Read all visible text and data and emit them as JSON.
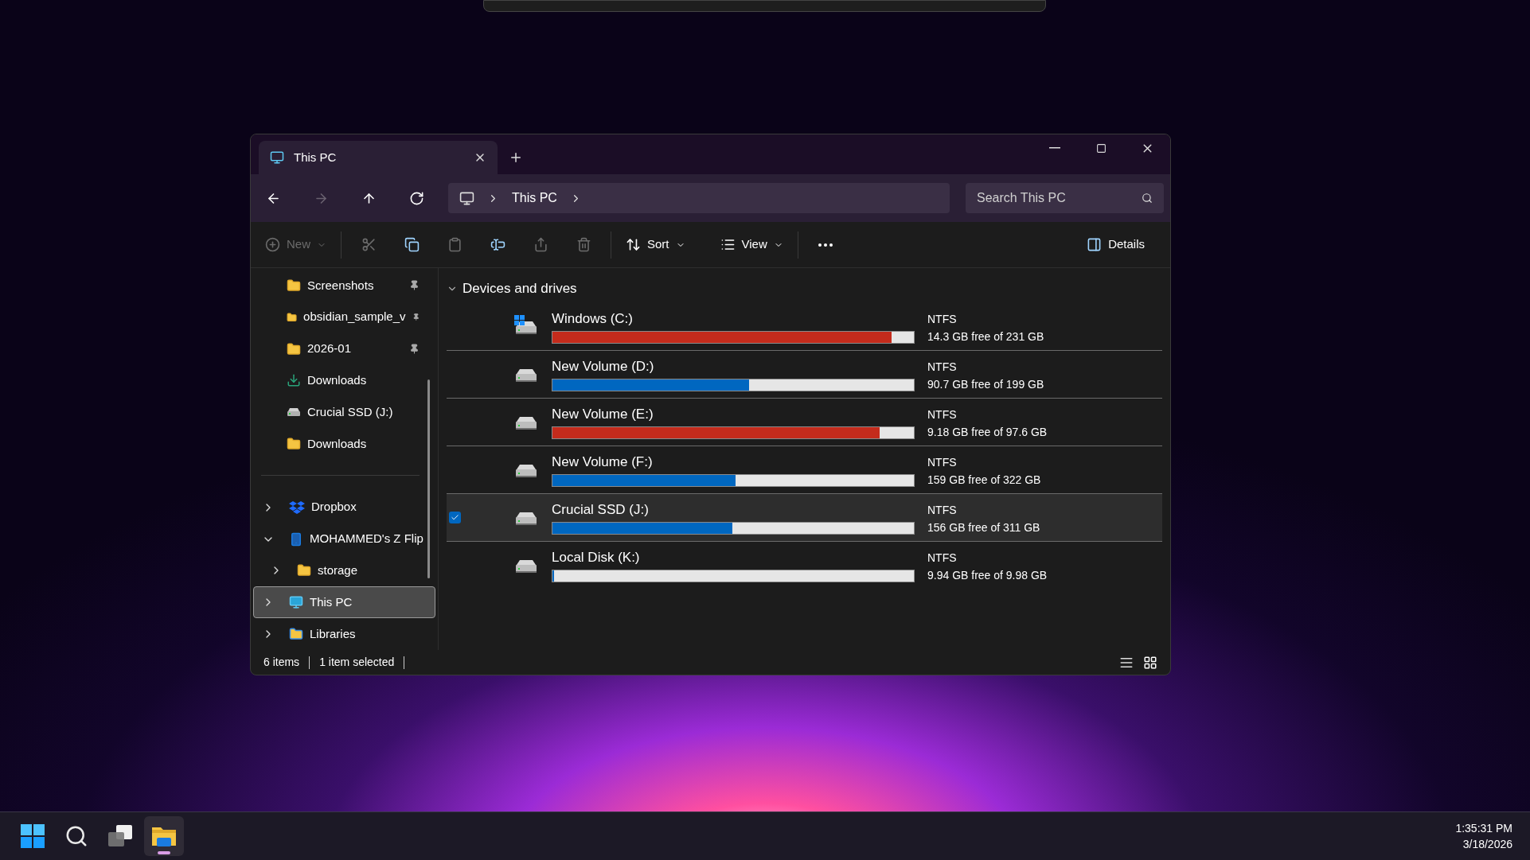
{
  "tab": {
    "title": "This PC"
  },
  "nav": {
    "buttons": [
      {
        "kind": "back",
        "disabled": false
      },
      {
        "kind": "forward",
        "disabled": true
      },
      {
        "kind": "up",
        "disabled": false
      },
      {
        "kind": "refresh",
        "disabled": false
      }
    ]
  },
  "address": {
    "crumbs": [
      "This PC"
    ]
  },
  "search": {
    "placeholder": "Search This PC"
  },
  "toolbar": {
    "items": [
      {
        "kind": "new",
        "label": "New",
        "disabled": true
      },
      {
        "kind": "cut",
        "disabled": true
      },
      {
        "kind": "copy",
        "disabled": false
      },
      {
        "kind": "paste",
        "disabled": true
      },
      {
        "kind": "rename",
        "disabled": false
      },
      {
        "kind": "share",
        "disabled": true
      },
      {
        "kind": "delete",
        "disabled": true
      },
      {
        "kind": "sort",
        "label": "Sort",
        "disabled": false
      },
      {
        "kind": "view",
        "label": "View",
        "disabled": false
      },
      {
        "kind": "more",
        "disabled": false
      },
      {
        "kind": "details",
        "label": "Details",
        "disabled": false
      }
    ]
  },
  "sidebar": {
    "quick_access": [
      {
        "label": "Screenshots",
        "kind": "folder",
        "pinned": true,
        "selected": false
      },
      {
        "label": "obsidian_sample_v",
        "kind": "folder",
        "pinned": true,
        "selected": false
      },
      {
        "label": "2026-01",
        "kind": "folder",
        "pinned": true,
        "selected": false
      },
      {
        "label": "Downloads",
        "kind": "download",
        "pinned": false,
        "selected": false
      },
      {
        "label": "Crucial SSD (J:)",
        "kind": "drive",
        "pinned": false,
        "selected": false
      },
      {
        "label": "Downloads",
        "kind": "folder",
        "pinned": false,
        "selected": false
      }
    ],
    "tree": [
      {
        "label": "Dropbox",
        "kind": "dropbox",
        "expanded": false,
        "selected": false
      },
      {
        "label": "MOHAMMED's Z Flip",
        "kind": "phone",
        "expanded": true,
        "selected": false,
        "children": [
          {
            "label": "storage",
            "kind": "folder",
            "expanded": false,
            "selected": false
          }
        ]
      },
      {
        "label": "This PC",
        "kind": "pc",
        "expanded": false,
        "selected": true
      },
      {
        "label": "Libraries",
        "kind": "library",
        "expanded": false,
        "selected": false
      }
    ]
  },
  "section": {
    "title": "Devices and drives",
    "expanded": true
  },
  "drives": [
    {
      "name": "Windows (C:)",
      "kind": "system",
      "level": 0.938,
      "color": "#c42b1c",
      "filesystem": "NTFS",
      "space": "14.3 GB free of 231 GB",
      "selected": false
    },
    {
      "name": "New Volume (D:)",
      "kind": "disk",
      "level": 0.544,
      "color": "#0067c0",
      "filesystem": "NTFS",
      "space": "90.7 GB free of 199 GB",
      "selected": false
    },
    {
      "name": "New Volume (E:)",
      "kind": "disk",
      "level": 0.906,
      "color": "#c42b1c",
      "filesystem": "NTFS",
      "space": "9.18 GB free of 97.6 GB",
      "selected": false
    },
    {
      "name": "New Volume (F:)",
      "kind": "disk",
      "level": 0.506,
      "color": "#0067c0",
      "filesystem": "NTFS",
      "space": "159 GB free of 322 GB",
      "selected": false
    },
    {
      "name": "Crucial SSD (J:)",
      "kind": "disk",
      "level": 0.498,
      "color": "#0067c0",
      "filesystem": "NTFS",
      "space": "156 GB free of 311 GB",
      "selected": true
    },
    {
      "name": "Local Disk (K:)",
      "kind": "disk",
      "level": 0.004,
      "color": "#0067c0",
      "filesystem": "NTFS",
      "space": "9.94 GB free of 9.98 GB",
      "selected": false
    }
  ],
  "status_bar": {
    "item_count": "6 items",
    "selection": "1 item selected"
  },
  "taskbar": {
    "apps": [
      {
        "kind": "start",
        "active": false
      },
      {
        "kind": "search",
        "active": false
      },
      {
        "kind": "task_view",
        "active": false
      },
      {
        "kind": "file_explorer",
        "active": true
      }
    ],
    "time": "1:35:31 PM",
    "date": "3/18/2026"
  }
}
